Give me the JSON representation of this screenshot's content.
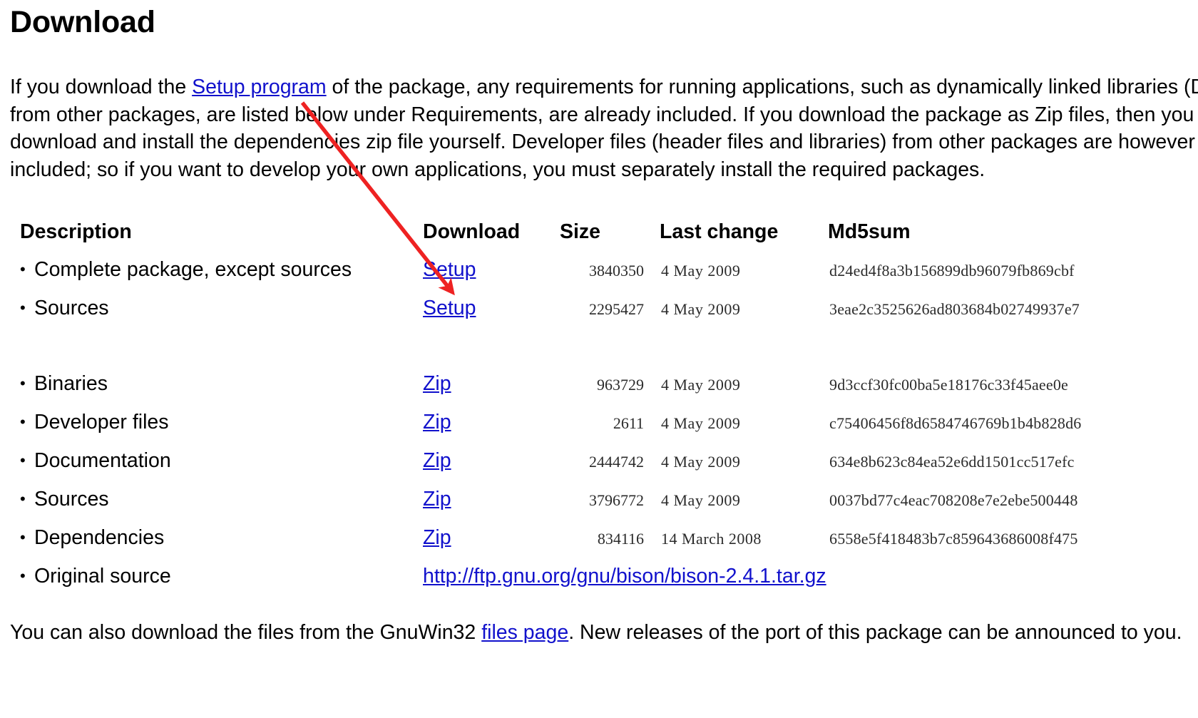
{
  "page": {
    "title": "Download",
    "intro_before_link": "If you download the ",
    "intro_link": "Setup program",
    "intro_after_link": " of the package, any requirements for running applications, such as dynamically linked libraries (DLL's) from other packages, are listed below under Requirements, are already included. If you download the package as Zip files, then you must download and install the dependencies zip file yourself. Developer files (header files and libraries) from other packages are however not included; so if you want to develop your own applications, you must separately install the required packages.",
    "outro_before_link": "You can also download the files from the GnuWin32 ",
    "outro_link": "files page",
    "outro_after_link": ". New releases of the port of this package can be announced to you."
  },
  "table": {
    "headers": {
      "description": "Description",
      "download": "Download",
      "size": "Size",
      "last_change": "Last change",
      "md5sum": "Md5sum"
    },
    "setup_rows": [
      {
        "description": "Complete package, except sources",
        "download_label": "Setup",
        "size": "3840350",
        "last_change": "4 May 2009",
        "md5sum": "d24ed4f8a3b156899db96079fb869cbf"
      },
      {
        "description": "Sources",
        "download_label": "Setup",
        "size": "2295427",
        "last_change": "4 May 2009",
        "md5sum": "3eae2c3525626ad803684b02749937e7"
      }
    ],
    "zip_rows": [
      {
        "description": "Binaries",
        "download_label": "Zip",
        "size": "963729",
        "last_change": "4 May 2009",
        "md5sum": "9d3ccf30fc00ba5e18176c33f45aee0e"
      },
      {
        "description": "Developer files",
        "download_label": "Zip",
        "size": "2611",
        "last_change": "4 May 2009",
        "md5sum": "c75406456f8d6584746769b1b4b828d6"
      },
      {
        "description": "Documentation",
        "download_label": "Zip",
        "size": "2444742",
        "last_change": "4 May 2009",
        "md5sum": "634e8b623c84ea52e6dd1501cc517efc"
      },
      {
        "description": "Sources",
        "download_label": "Zip",
        "size": "3796772",
        "last_change": "4 May 2009",
        "md5sum": "0037bd77c4eac708208e7e2ebe500448"
      },
      {
        "description": "Dependencies",
        "download_label": "Zip",
        "size": "834116",
        "last_change": "14 March 2008",
        "md5sum": "6558e5f418483b7c859643686008f475"
      }
    ],
    "original_source_row": {
      "description": "Original source",
      "download_label": "http://ftp.gnu.org/gnu/bison/bison-2.4.1.tar.gz"
    },
    "bullet_glyph": "•"
  },
  "annotation": {
    "arrow_color": "#ee2222",
    "name": "red-arrow-annotation"
  }
}
